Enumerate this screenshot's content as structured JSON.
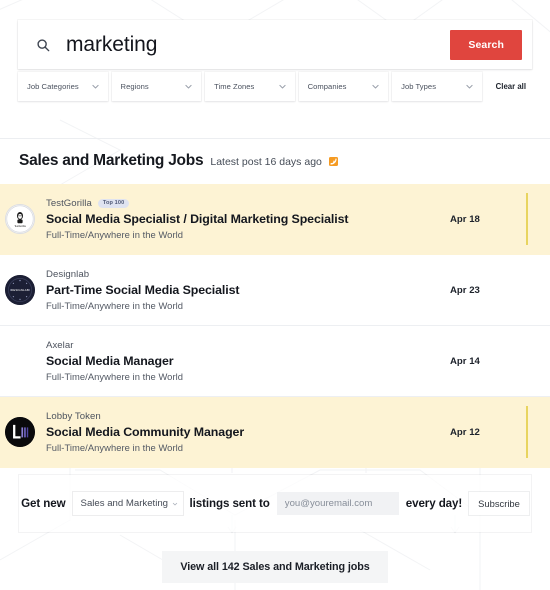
{
  "search": {
    "value": "marketing",
    "placeholder": "Search",
    "button_label": "Search",
    "icon": "search-icon"
  },
  "filters": {
    "items": [
      {
        "label": "Job Categories",
        "icon": "chevron-down-icon"
      },
      {
        "label": "Regions",
        "icon": "chevron-down-icon"
      },
      {
        "label": "Time Zones",
        "icon": "chevron-down-icon"
      },
      {
        "label": "Companies",
        "icon": "chevron-down-icon"
      },
      {
        "label": "Job Types",
        "icon": "chevron-down-icon"
      }
    ],
    "clear_all_label": "Clear all"
  },
  "section": {
    "title": "Sales and Marketing Jobs",
    "meta": "Latest post 16 days ago",
    "rss_icon": "rss-icon"
  },
  "jobs": [
    {
      "company": "TestGorilla",
      "badge": "Top 100",
      "title": "Social Media Specialist / Digital Marketing Specialist",
      "tags": "Full-Time/Anywhere in the World",
      "date": "Apr 18",
      "featured": true,
      "logo": "testgorilla-logo"
    },
    {
      "company": "Designlab",
      "badge": "",
      "title": "Part-Time Social Media Specialist",
      "tags": "Full-Time/Anywhere in the World",
      "date": "Apr 23",
      "featured": false,
      "logo": "designlab-logo"
    },
    {
      "company": "Axelar",
      "badge": "",
      "title": "Social Media Manager",
      "tags": "Full-Time/Anywhere in the World",
      "date": "Apr 14",
      "featured": false,
      "logo": ""
    },
    {
      "company": "Lobby Token",
      "badge": "",
      "title": "Social Media Community Manager",
      "tags": "Full-Time/Anywhere in the World",
      "date": "Apr 12",
      "featured": true,
      "logo": "lobby-token-logo"
    }
  ],
  "subscribe": {
    "prefix": "Get new",
    "category": "Sales and Marketing",
    "middle": "listings sent to",
    "email_placeholder": "you@youremail.com",
    "email_value": "",
    "suffix": "every day!",
    "button_label": "Subscribe"
  },
  "view_all": {
    "label": "View all 142 Sales and Marketing jobs"
  },
  "colors": {
    "accent_red": "#e0453e",
    "featured_bg": "#fdf3d4",
    "featured_bar": "#e8d45f",
    "rss_orange": "#f59b23",
    "badge_bg": "#dfe3f0"
  }
}
